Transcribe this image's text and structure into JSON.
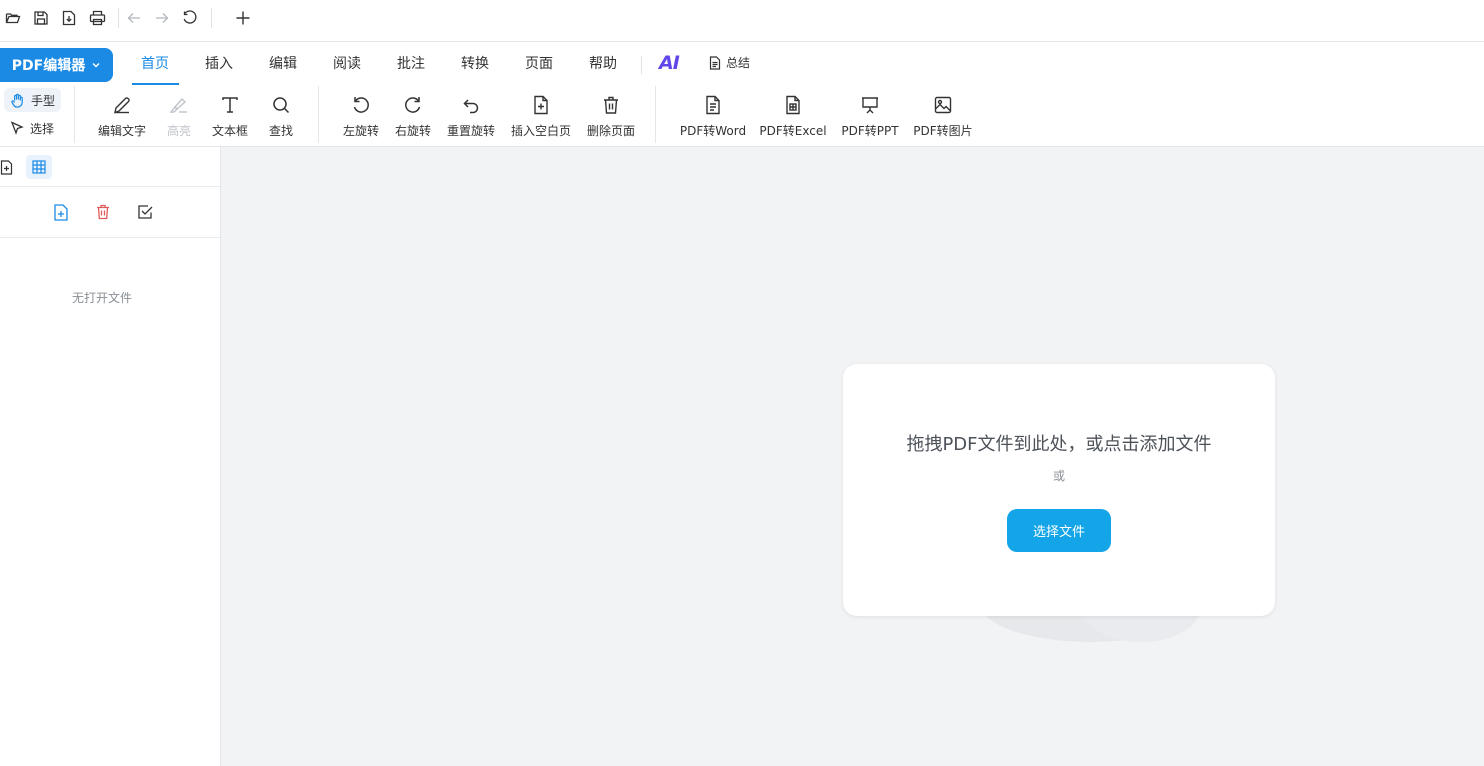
{
  "quickbar": {
    "icons": [
      "folder-open-icon",
      "save-icon",
      "save-as-icon",
      "print-icon",
      "undo-icon",
      "redo-icon",
      "refresh-icon",
      "new-tab-icon"
    ]
  },
  "menu": {
    "app_label": "PDF编辑器",
    "items": [
      {
        "label": "首页",
        "active": true
      },
      {
        "label": "插入"
      },
      {
        "label": "编辑"
      },
      {
        "label": "阅读"
      },
      {
        "label": "批注"
      },
      {
        "label": "转换"
      },
      {
        "label": "页面"
      },
      {
        "label": "帮助"
      }
    ],
    "ai_label": "AI",
    "summary_label": "总结"
  },
  "modes": {
    "hand": "手型",
    "select": "选择"
  },
  "tools": {
    "edit_text": "编辑文字",
    "highlight": "高亮",
    "textbox": "文本框",
    "find": "查找",
    "rotate_left": "左旋转",
    "rotate_right": "右旋转",
    "reset_rotate": "重置旋转",
    "insert_blank": "插入空白页",
    "delete_page": "删除页面",
    "pdf_word": "PDF转Word",
    "pdf_excel": "PDF转Excel",
    "pdf_ppt": "PDF转PPT",
    "pdf_image": "PDF转图片"
  },
  "sidebar": {
    "empty_text": "无打开文件"
  },
  "dropzone": {
    "title": "拖拽PDF文件到此处，或点击添加文件",
    "or": "或",
    "button": "选择文件"
  },
  "colors": {
    "accent": "#1a8ae5",
    "button": "#13a5e8",
    "ai": "#6246ea",
    "delete": "#e05a5a"
  }
}
